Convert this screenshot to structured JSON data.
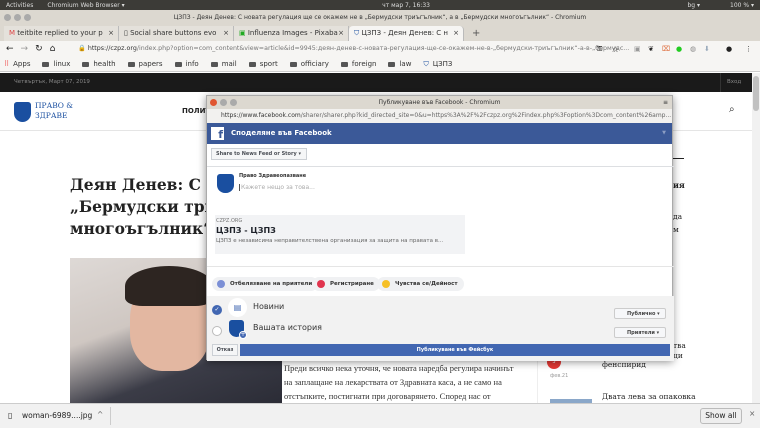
{
  "system": {
    "activities": "Activities",
    "app": "Chromium Web Browser ▾",
    "clock": "чт мар  7, 16:33",
    "lang": "bg ▾",
    "battery": "100 % ▾"
  },
  "window": {
    "title": "ЦЗПЗ - Деян Денев: С новата регулация ще се окажем не в „Бермудски триъгълник“, а в „Бермудски многоъгълник“ - Chromium"
  },
  "tabs": [
    {
      "label": "teitbite replied to your p"
    },
    {
      "label": "Social share buttons evo"
    },
    {
      "label": "Influenza Images - Pixaba"
    },
    {
      "label": "ЦЗПЗ - Деян Денев: С н"
    }
  ],
  "address": {
    "host": "https://czpz.org",
    "path": "/index.php?option=com_content&view=article&id=9945:деян-денев-с-новата-регулация-ще-се-окажем-не-в-„бермудски-триъгълник“-а-в-„бермудс..."
  },
  "bookmarks": [
    "Apps",
    "linux",
    "health",
    "papers",
    "info",
    "mail",
    "sport",
    "officiary",
    "foreign",
    "law",
    "ЦЗПЗ"
  ],
  "site": {
    "date": "Четвъртък, Март 07, 2019",
    "login": "Вход",
    "logo_line1": "ПРАВО &",
    "logo_line2": "ЗДРАВЕ",
    "nav_first": "ПОЛИТ",
    "title_lines": [
      "Деян Денев: С но",
      "„Бермудски трит",
      "многоъгълник“"
    ],
    "body": [
      "Преди всичко нека уточня, че новата наредба регулира начинът",
      "на заплащане на лекарствата от Здравната каса, а не само на",
      "отстъпките, постигнати при договарянето. Според нас от"
    ],
    "side": {
      "frag1": "ия",
      "frag2": "да",
      "frag3": "м",
      "frag4": "тва",
      "frag5": "ци",
      "item_title": "фенспирид",
      "badge": "3",
      "date": "фев.21",
      "item2_title": "Двата лева за опаковка"
    }
  },
  "popup": {
    "title": "Публикуване във Facebook - Chromium",
    "url_host": "https://www.facebook.com",
    "url_path": "/sharer/sharer.php?kid_directed_site=0&u=https%3A%2F%2Fczpz.org%2Findex.php%3Foption%3Dcom_content%26amp...",
    "header": "Споделяне във Facebook",
    "share_to": "Share to News Feed or Story",
    "page_name": "Право Здравеопазване",
    "placeholder": "Кажете нещо за това...",
    "card": {
      "domain": "CZPZ.ORG",
      "title": "ЦЗПЗ - ЦЗПЗ",
      "desc": "ЦЗПЗ е независима неправителствена организация за защита на правата в..."
    },
    "chips": [
      "Отбелязване на приятели",
      "Регистриране",
      "Чувства се/Дейност"
    ],
    "news_feed": "Новини",
    "story": "Вашата история",
    "audience_feed": "Публично",
    "audience_story": "Приятели",
    "cancel": "Отказ",
    "publish": "Публикуване във Фейсбук"
  },
  "download": {
    "file": "woman-6989....jpg",
    "show_all": "Show all"
  },
  "colors": {
    "fb": "#3b5998",
    "publish": "#4267b2"
  }
}
